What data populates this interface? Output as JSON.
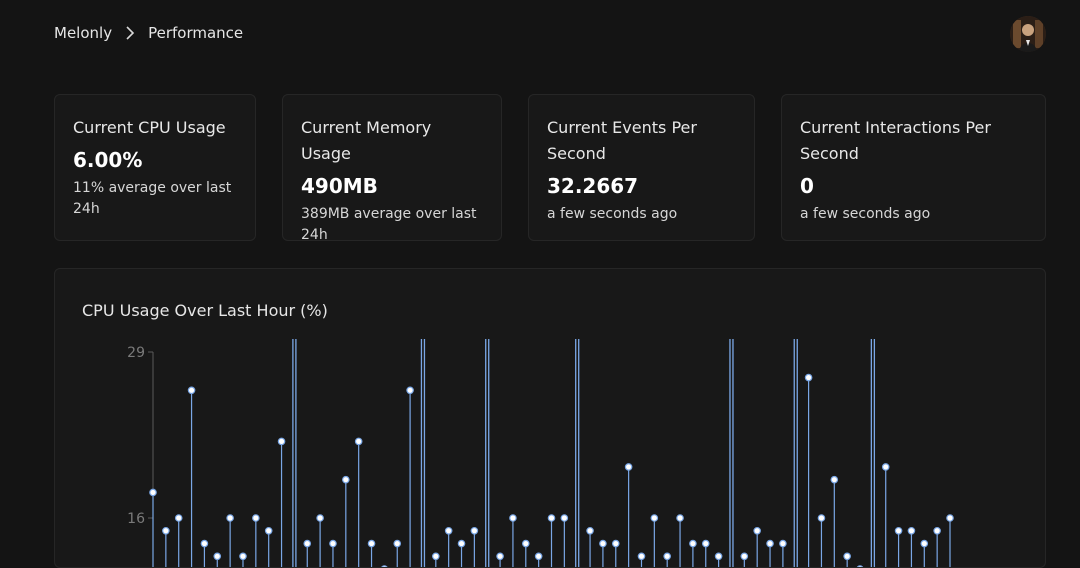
{
  "breadcrumb": {
    "root": "Melonly",
    "current": "Performance"
  },
  "cards": [
    {
      "title": "Current CPU Usage",
      "value": "6.00%",
      "sub": "11% average over last 24h"
    },
    {
      "title": "Current Memory Usage",
      "value": "490MB",
      "sub": "389MB average over last 24h"
    },
    {
      "title": "Current Events Per Second",
      "value": "32.2667",
      "sub": "a few seconds ago"
    },
    {
      "title": "Current Interactions Per Second",
      "value": "0",
      "sub": "a few seconds ago"
    }
  ],
  "chart_title": "CPU Usage Over Last Hour (%)",
  "chart_data": {
    "type": "line",
    "title": "CPU Usage Over Last Hour (%)",
    "xlabel": "",
    "ylabel": "",
    "y_ticks": [
      "29",
      "16"
    ],
    "ylim": [
      3,
      29
    ],
    "grid": false,
    "series": [
      {
        "color": "#7aa7e6",
        "values": [
          18,
          15,
          16,
          26,
          14,
          13,
          16,
          13,
          16,
          15,
          22,
          33,
          14,
          16,
          14,
          19,
          22,
          14,
          12,
          14,
          26,
          32,
          13,
          15,
          14,
          15,
          33,
          13,
          16,
          14,
          13,
          16,
          16,
          33,
          15,
          14,
          14,
          20,
          13,
          16,
          13,
          16,
          14,
          14,
          13,
          33,
          13,
          15,
          14,
          14,
          33,
          27,
          16,
          19,
          13,
          12,
          33,
          20,
          15,
          15,
          14,
          15,
          16
        ]
      }
    ]
  }
}
